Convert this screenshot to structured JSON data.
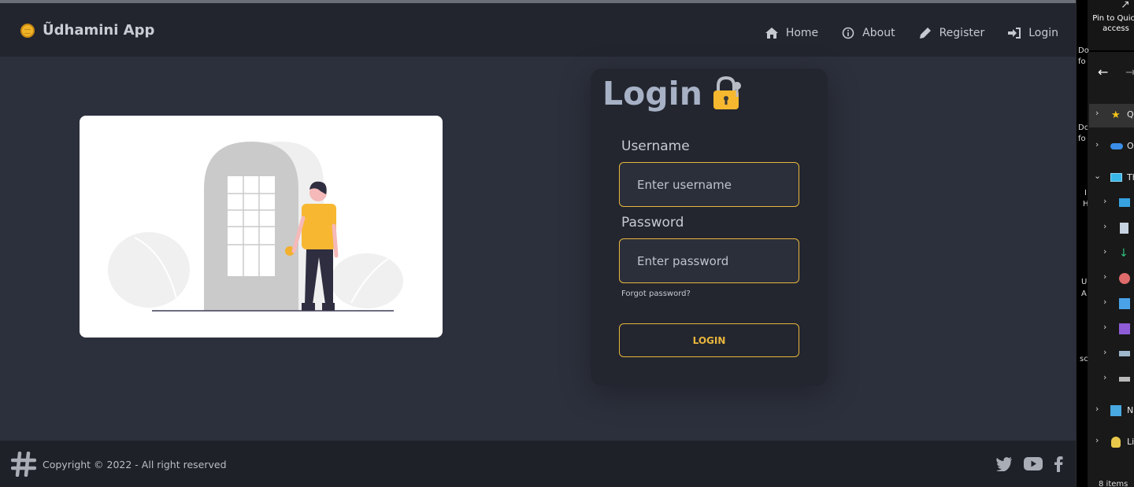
{
  "app": {
    "brand": "Ũdhamini App",
    "nav": [
      {
        "label": "Home",
        "icon": "home-icon"
      },
      {
        "label": "About",
        "icon": "info-icon"
      },
      {
        "label": "Register",
        "icon": "pencil-icon"
      },
      {
        "label": "Login",
        "icon": "sign-in-icon"
      }
    ],
    "login": {
      "title": "Login",
      "username_label": "Username",
      "username_placeholder": "Enter username",
      "password_label": "Password",
      "password_placeholder": "Enter password",
      "forgot": "Forgot password?",
      "submit": "LOGIN"
    },
    "footer": {
      "copyright": "Copyright © 2022 - All right reserved",
      "socials": [
        "twitter-icon",
        "youtube-icon",
        "facebook-icon"
      ]
    },
    "colors": {
      "accent": "#e8b53e",
      "navbar": "#22252e",
      "background": "#2c303c",
      "card": "#23262f",
      "footer": "#1e2128"
    }
  },
  "explorer": {
    "pin_text": "Pin to Quick access",
    "fragments": [
      "Do",
      "fo",
      "Do",
      "fo",
      "I",
      "H",
      "U",
      "A",
      "sc"
    ],
    "tree": [
      {
        "label": "Q",
        "icon": "star-icon",
        "expanded": false
      },
      {
        "label": "O",
        "icon": "cloud-icon",
        "expanded": false
      },
      {
        "label": "Th",
        "icon": "monitor-icon",
        "expanded": true
      },
      {
        "label": "",
        "icon": "desktop-folder-icon",
        "expanded": false
      },
      {
        "label": "",
        "icon": "documents-icon",
        "expanded": false
      },
      {
        "label": "",
        "icon": "downloads-icon",
        "expanded": false
      },
      {
        "label": "",
        "icon": "music-icon",
        "expanded": false
      },
      {
        "label": "",
        "icon": "pictures-icon",
        "expanded": false
      },
      {
        "label": "",
        "icon": "videos-icon",
        "expanded": false
      },
      {
        "label": "",
        "icon": "drive-icon",
        "expanded": false
      },
      {
        "label": "",
        "icon": "drive-icon",
        "expanded": false
      },
      {
        "label": "N",
        "icon": "network-icon",
        "expanded": false
      },
      {
        "label": "Li",
        "icon": "linux-icon",
        "expanded": false
      }
    ],
    "status": "8 items"
  }
}
